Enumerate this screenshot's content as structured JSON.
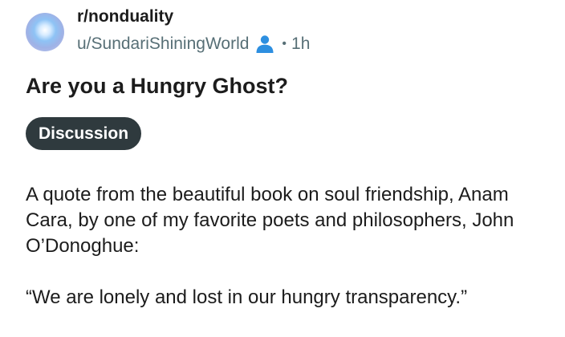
{
  "post": {
    "subreddit": "r/nonduality",
    "username": "u/SundariShiningWorld",
    "separator": "•",
    "time": "1h",
    "title": "Are you a Hungry Ghost?",
    "flair": "Discussion",
    "paragraphs": [
      "A quote from the beautiful book on soul friendship, Anam Cara, by one of my favorite poets and philosophers, John O’Donoghue:",
      "“We are lonely and lost in our hungry transparency.”"
    ]
  },
  "icons": {
    "avatar": "subreddit-avatar",
    "user": "user-icon"
  },
  "colors": {
    "text": "#1c1c1c",
    "meta": "#576f76",
    "user_icon": "#2d8fe0",
    "flair_bg": "#2f3a3e",
    "flair_text": "#ffffff"
  }
}
